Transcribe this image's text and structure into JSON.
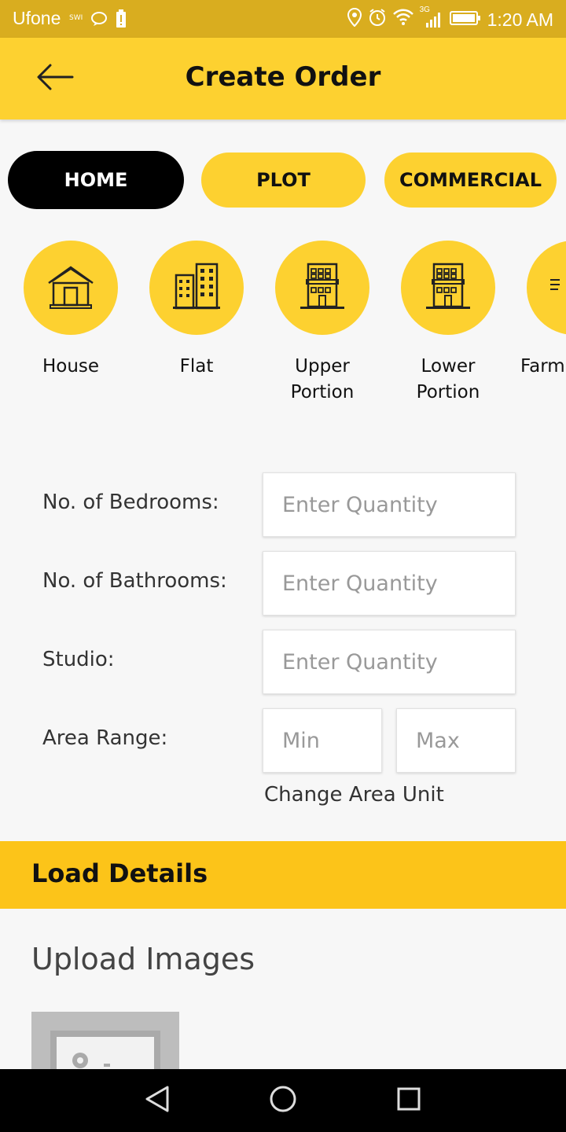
{
  "status_bar": {
    "carrier": "Ufone",
    "carrier_small": "SWI",
    "network": "3G",
    "time": "1:20 AM",
    "icons": [
      "chat-icon",
      "battery-alert-icon",
      "location-icon",
      "alarm-icon",
      "wifi-icon",
      "signal-icon",
      "battery-icon"
    ]
  },
  "app_bar": {
    "back_icon": "arrow-left-icon",
    "title": "Create Order"
  },
  "categories": [
    {
      "label": "HOME",
      "active": true
    },
    {
      "label": "PLOT",
      "active": false
    },
    {
      "label": "COMMERCIAL",
      "active": false
    }
  ],
  "property_types": [
    {
      "label": "House",
      "icon": "house-icon"
    },
    {
      "label": "Flat",
      "icon": "flat-icon"
    },
    {
      "label": "Upper Portion",
      "icon": "building-icon"
    },
    {
      "label": "Lower Portion",
      "icon": "building-icon"
    },
    {
      "label": "Farm",
      "icon": "farm-icon"
    }
  ],
  "form": {
    "bedrooms_label": "No. of Bedrooms:",
    "bedrooms_placeholder": "Enter Quantity",
    "bathrooms_label": "No. of Bathrooms:",
    "bathrooms_placeholder": "Enter Quantity",
    "studio_label": "Studio:",
    "studio_placeholder": "Enter Quantity",
    "area_label": "Area Range:",
    "area_min_placeholder": "Min",
    "area_max_placeholder": "Max",
    "change_unit": "Change Area Unit"
  },
  "load_details": {
    "title": "Load Details"
  },
  "upload": {
    "title": "Upload Images",
    "placeholder_icon": "image-placeholder-icon"
  },
  "nav_bar": {
    "back": "back-triangle-icon",
    "home": "home-circle-icon",
    "recents": "recents-square-icon"
  },
  "colors": {
    "accent": "#fdd130",
    "status_bar": "#d9ad1f",
    "banner": "#fcc419",
    "active_pill": "#000000"
  }
}
